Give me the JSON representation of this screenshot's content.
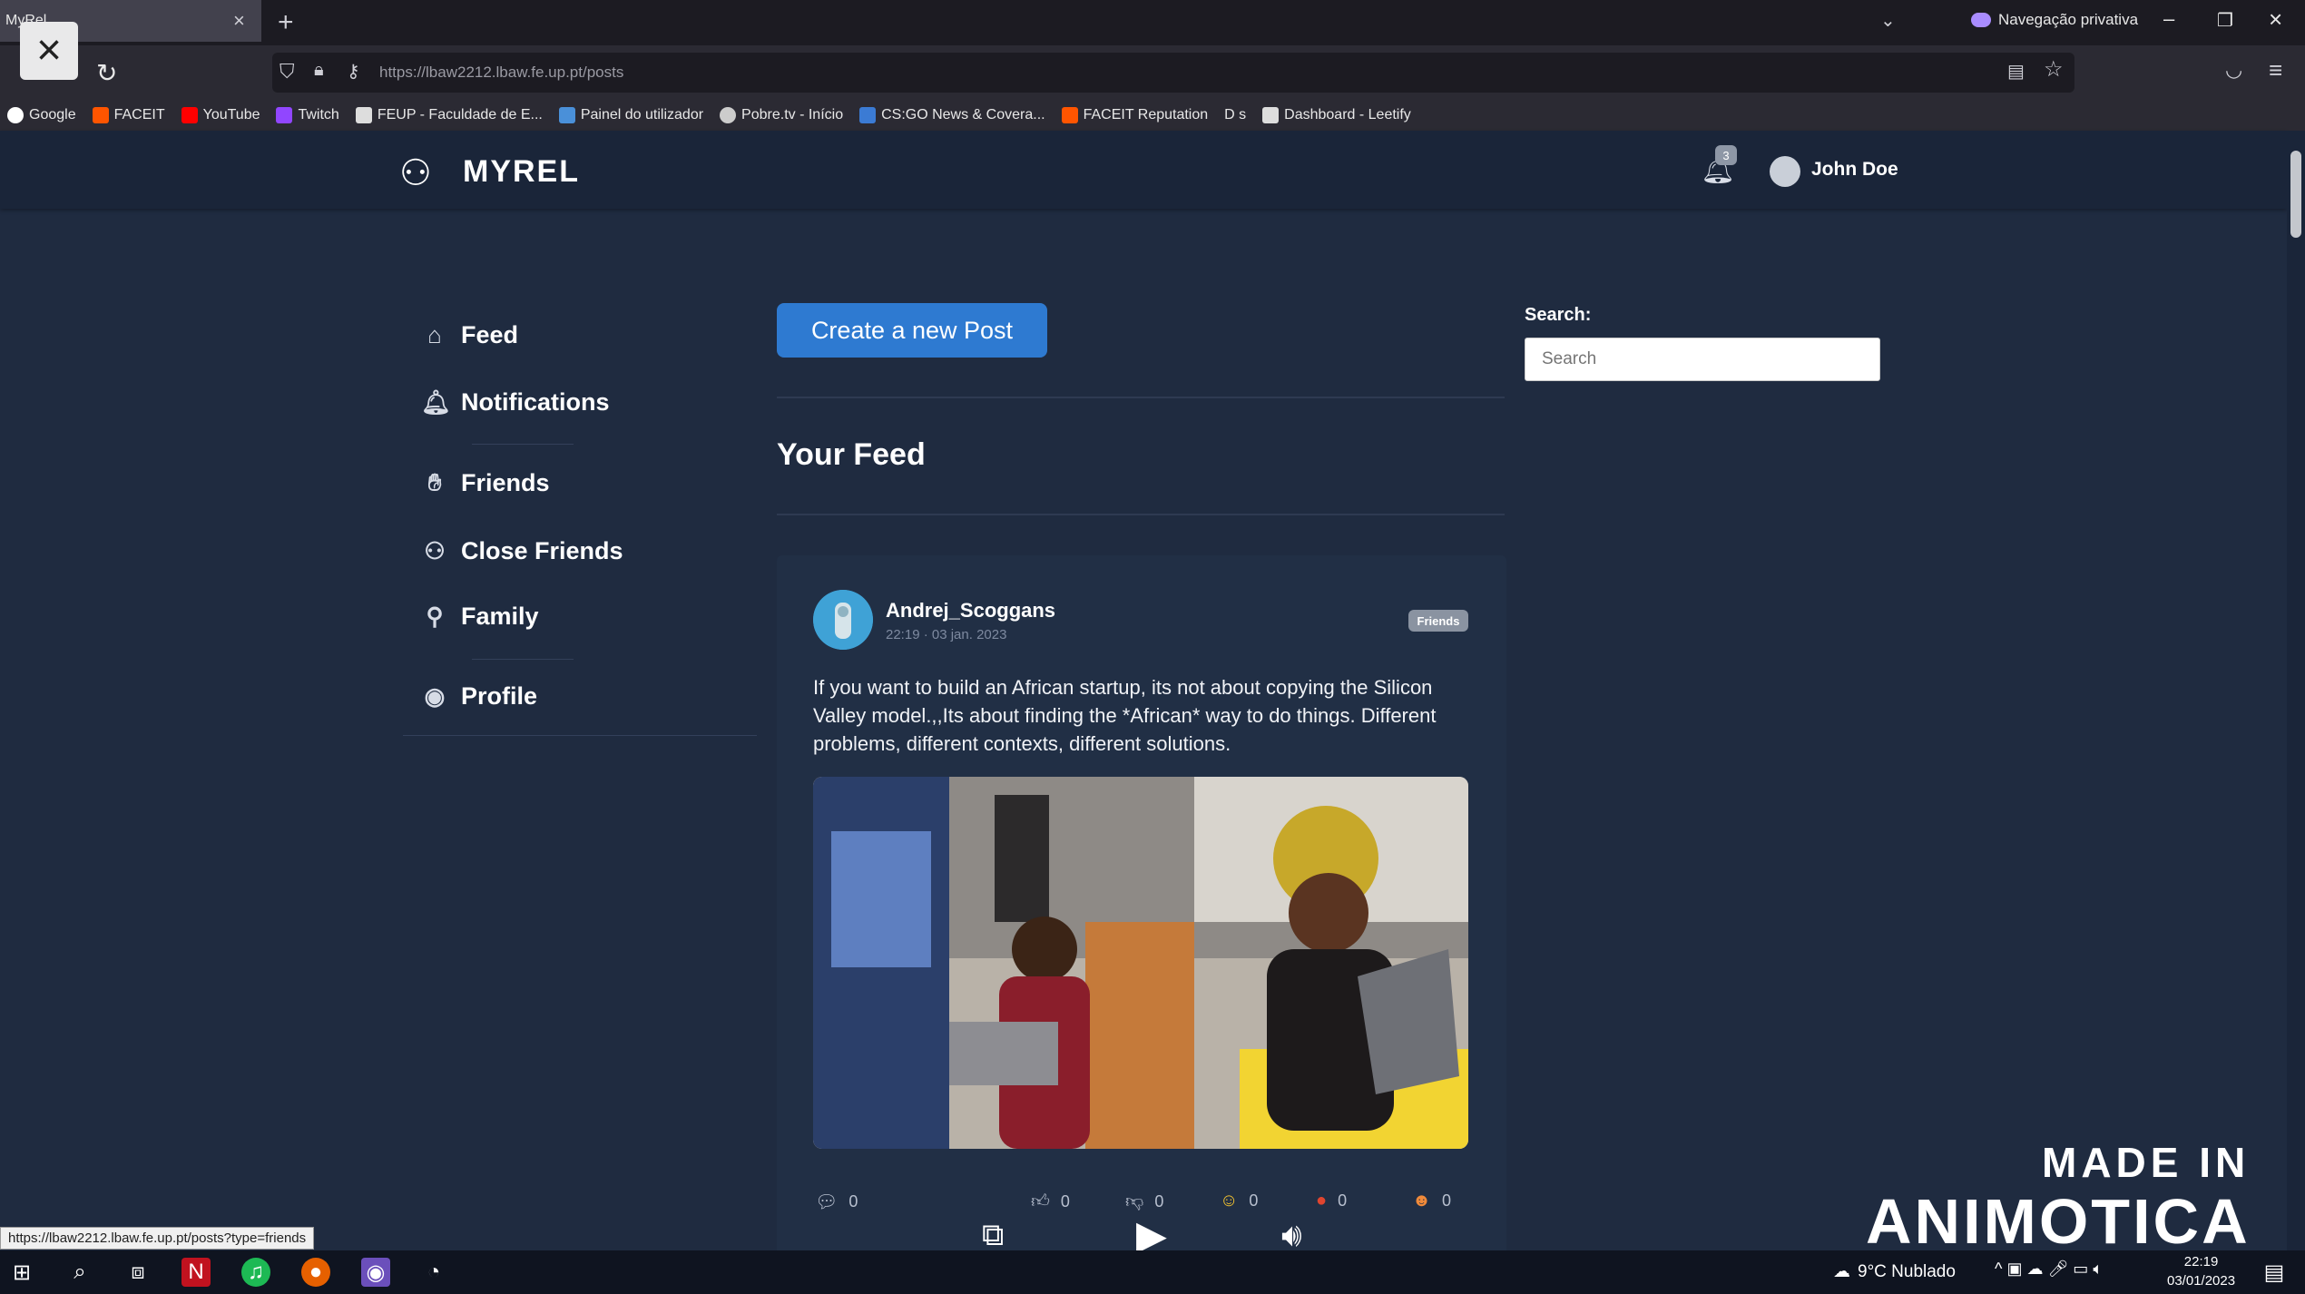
{
  "browser": {
    "tab_title": "MyRel",
    "tab_close": "×",
    "new_tab": "+",
    "tab_list": "⌄",
    "private_label": "Navegação privativa",
    "url": "https://lbaw2212.lbaw.fe.up.pt/posts",
    "status_url": "https://lbaw2212.lbaw.fe.up.pt/posts?type=friends",
    "bookmarks": [
      {
        "label": "Google",
        "color": "#ffffff"
      },
      {
        "label": "FACEIT",
        "color": "#ff5500"
      },
      {
        "label": "YouTube",
        "color": "#ff0000"
      },
      {
        "label": "Twitch",
        "color": "#9146ff"
      },
      {
        "label": "FEUP - Faculdade de E...",
        "color": "#dddddd"
      },
      {
        "label": "Painel do utilizador",
        "color": "#4a90d9"
      },
      {
        "label": "Pobre.tv - Início",
        "color": "#cccccc"
      },
      {
        "label": "CS:GO News & Covera...",
        "color": "#3b7bd4"
      },
      {
        "label": "FACEIT Reputation",
        "color": "#ff5500"
      },
      {
        "label": "D  s",
        "color": "#444444"
      },
      {
        "label": "Dashboard - Leetify",
        "color": "#dddddd"
      }
    ]
  },
  "site": {
    "logo_text": "MYREL",
    "notification_count": "3",
    "user_name": "John Doe",
    "sidebar": [
      {
        "label": "Feed",
        "icon": "home-icon"
      },
      {
        "label": "Notifications",
        "icon": "bell-icon"
      },
      {
        "label": "Friends",
        "icon": "hand-icon"
      },
      {
        "label": "Close Friends",
        "icon": "people-icon"
      },
      {
        "label": "Family",
        "icon": "family-icon"
      },
      {
        "label": "Profile",
        "icon": "profile-icon"
      }
    ],
    "create_button": "Create a new Post",
    "feed_title": "Your Feed",
    "search_label": "Search:",
    "search_placeholder": "Search",
    "post": {
      "author": "Andrej_Scoggans",
      "time": "22:19 · 03 jan. 2023",
      "audience": "Friends",
      "text": "If you want to build an African startup, its not about copying the Silicon Valley model.,,Its about finding the *African* way to do things. Different problems, different contexts, different solutions.",
      "comments": "0",
      "reactions": [
        {
          "icon": "thumbs-up-icon",
          "count": "0"
        },
        {
          "icon": "thumbs-down-icon",
          "count": "0"
        },
        {
          "icon": "laugh-icon",
          "count": "0"
        },
        {
          "icon": "angry-icon",
          "count": "0"
        },
        {
          "icon": "love-icon",
          "count": "0"
        }
      ]
    }
  },
  "watermark": {
    "line1": "MADE IN",
    "line2": "ANIMOTICA"
  },
  "taskbar": {
    "weather": "9°C  Nublado",
    "time": "22:19",
    "date": "03/01/2023"
  }
}
